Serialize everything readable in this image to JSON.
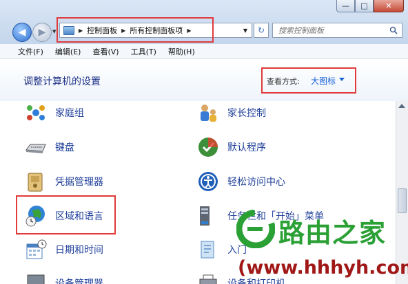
{
  "window": {
    "buttons": {
      "minimize": "—",
      "maximize": "□",
      "close": "✕"
    }
  },
  "nav": {
    "back_icon": "back-arrow-icon",
    "forward_icon": "forward-arrow-icon",
    "breadcrumbs": [
      "控制面板",
      "所有控制面板项"
    ],
    "search_placeholder": "搜索控制面板"
  },
  "menubar": [
    "文件(F)",
    "编辑(E)",
    "查看(V)",
    "工具(T)",
    "帮助(H)"
  ],
  "header": {
    "title": "调整计算机的设置",
    "view_by_label": "查看方式:",
    "view_by_value": "大图标"
  },
  "items": [
    {
      "label": "家庭组",
      "icon": "homegroup-icon"
    },
    {
      "label": "家长控制",
      "icon": "parental-controls-icon"
    },
    {
      "label": "键盘",
      "icon": "keyboard-icon"
    },
    {
      "label": "默认程序",
      "icon": "default-programs-icon"
    },
    {
      "label": "凭据管理器",
      "icon": "credential-manager-icon"
    },
    {
      "label": "轻松访问中心",
      "icon": "ease-of-access-icon"
    },
    {
      "label": "区域和语言",
      "icon": "region-language-icon"
    },
    {
      "label": "任务栏和「开始」菜单",
      "icon": "taskbar-icon"
    },
    {
      "label": "日期和时间",
      "icon": "date-time-icon"
    },
    {
      "label": "入门",
      "icon": "getting-started-icon"
    },
    {
      "label": "设备管理器",
      "icon": "device-manager-icon"
    },
    {
      "label": "设备和打印机",
      "icon": "devices-printers-icon"
    }
  ],
  "watermark": {
    "brand": "路由之家",
    "url": "(www.hhhyh.com)"
  },
  "colors": {
    "highlight": "#e03a3a",
    "link": "#1f3f9a",
    "title": "#1e3287",
    "watermark_green": "#2aa035",
    "watermark_red": "#a01818"
  }
}
